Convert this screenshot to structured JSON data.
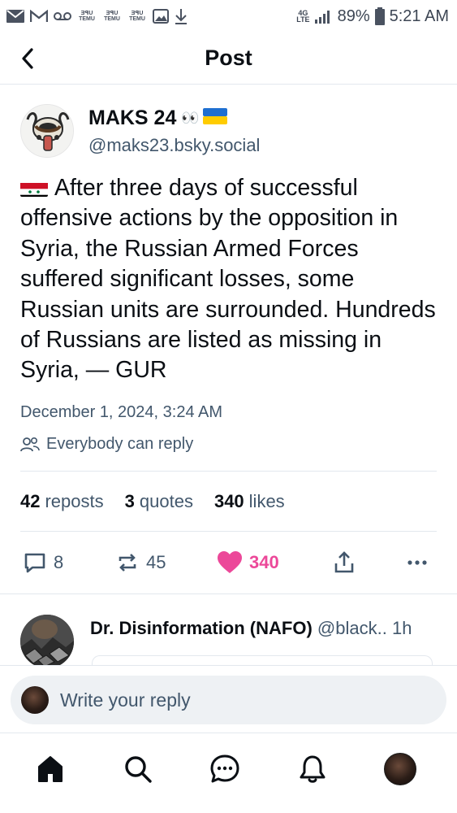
{
  "status_bar": {
    "left_icons": [
      "email-icon",
      "gmail-icon",
      "voicemail-icon",
      "temu-icon",
      "temu-icon",
      "temu-icon",
      "image-icon",
      "download-icon"
    ],
    "temu_label_top": "ƎꟼU",
    "temu_label": "TEMU",
    "network": "4G LTE",
    "battery": "89%",
    "time": "5:21 AM"
  },
  "header": {
    "title": "Post"
  },
  "post": {
    "author": {
      "display_name": "MAKS 24",
      "display_name_emoji": "👀",
      "handle": "@maks23.bsky.social"
    },
    "text": "After three days of successful offensive actions by the opposition in Syria, the Russian Armed Forces suffered significant losses, some Russian units are surrounded. Hundreds of Russians are listed as missing in Syria, — GUR",
    "timestamp": "December 1, 2024, 3:24 AM",
    "reply_setting": "Everybody can reply",
    "stats": {
      "reposts_count": "42",
      "reposts_label": "reposts",
      "quotes_count": "3",
      "quotes_label": "quotes",
      "likes_count": "340",
      "likes_label": "likes"
    },
    "actions": {
      "replies": "8",
      "reposts": "45",
      "likes": "340"
    }
  },
  "reply": {
    "display_name": "Dr. Disinformation (NAFO)",
    "handle": "@black..",
    "time": "1h"
  },
  "composer": {
    "placeholder": "Write your reply"
  },
  "colors": {
    "accent_like": "#ec4899",
    "secondary_text": "#42576c",
    "primary_text": "#0b0f14",
    "divider": "#e3e8ee",
    "composer_bg": "#eef1f4"
  }
}
